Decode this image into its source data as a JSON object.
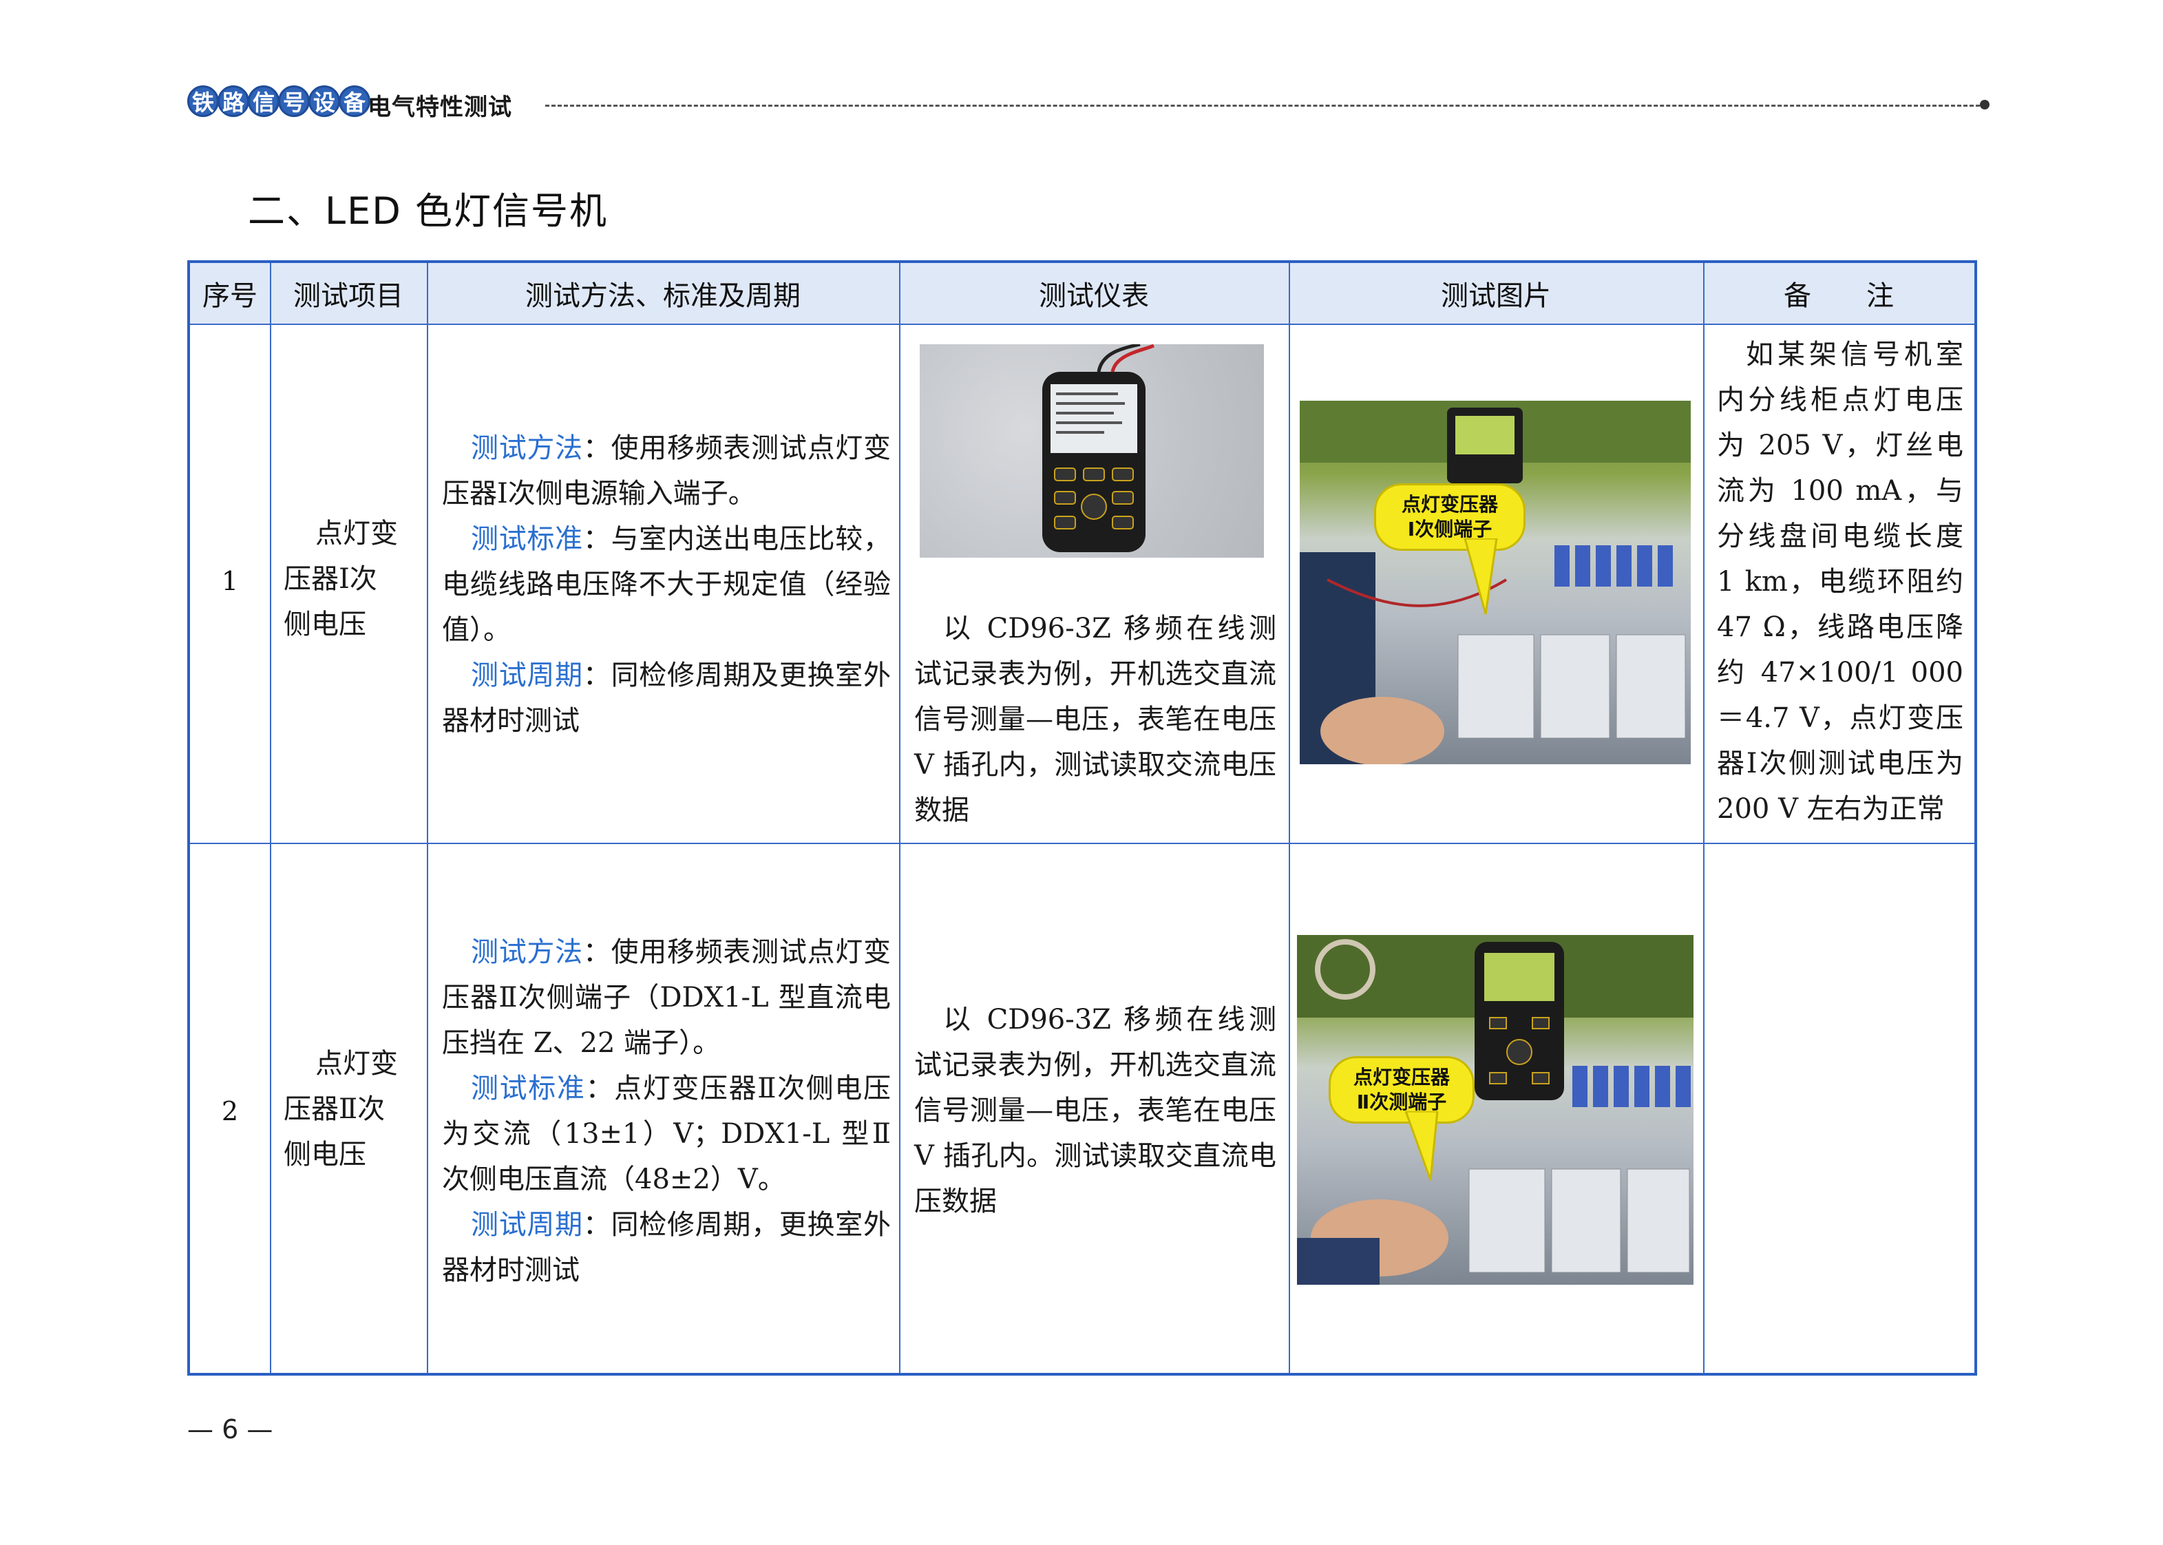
{
  "header": {
    "book_chars": [
      "铁",
      "路",
      "信",
      "号",
      "设",
      "备"
    ],
    "subtitle": "电气特性测试"
  },
  "section_title": "二、LED 色灯信号机",
  "table": {
    "headers": [
      "序号",
      "测试项目",
      "测试方法、标准及周期",
      "测试仪表",
      "测试图片",
      "备　　注"
    ],
    "rows": [
      {
        "no": "1",
        "item_lines": [
          "点灯变",
          "压器Ⅰ次",
          "侧电压"
        ],
        "method_label": "测试方法",
        "method_text": "：使用移频表测试点灯变压器Ⅰ次侧电源输入端子。",
        "standard_label": "测试标准",
        "standard_text": "：与室内送出电压比较，电缆线路电压降不大于规定值（经验值）。",
        "period_label": "测试周期",
        "period_text": "：同检修周期及更换室外器材时测试",
        "instrument": "以 CD96-3Z 移频在线测试记录表为例，开机选交直流信号测量—电压，表笔在电压 V 插孔内，测试读取交流电压数据",
        "photo_callout": "点灯变压器\nⅠ次侧端子",
        "remark": "如某架信号机室内分线柜点灯电压为 205 V，灯丝电流为 100 mA，与分线盘间电缆长度 1 km，电缆环阻约 47 Ω，线路电压降约 47×100/1 000＝4.7 V，点灯变压器Ⅰ次侧测试电压为 200 V 左右为正常"
      },
      {
        "no": "2",
        "item_lines": [
          "点灯变",
          "压器Ⅱ次",
          "侧电压"
        ],
        "method_label": "测试方法",
        "method_text": "：使用移频表测试点灯变压器Ⅱ次侧端子（DDX1-L 型直流电压挡在 Z、22 端子）。",
        "standard_label": "测试标准",
        "standard_text": "：点灯变压器Ⅱ次侧电压为交流（13±1）V；DDX1-L 型Ⅱ次侧电压直流（48±2）V。",
        "period_label": "测试周期",
        "period_text": "：同检修周期，更换室外器材时测试",
        "instrument": "以 CD96-3Z 移频在线测试记录表为例，开机选交直流信号测量—电压，表笔在电压 V 插孔内。测试读取交直流电压数据",
        "photo_callout": "点灯变压器\nⅡ次测端子",
        "remark": ""
      }
    ]
  },
  "page_number": "— 6 —"
}
